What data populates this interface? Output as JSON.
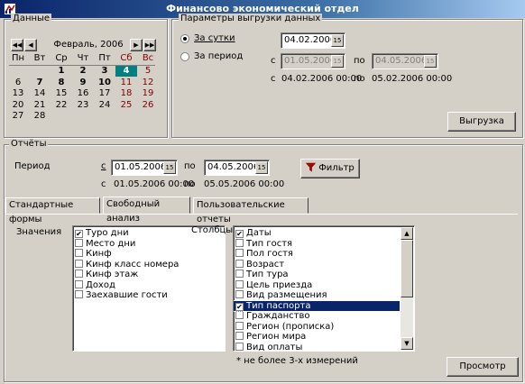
{
  "window": {
    "title": "Финансово экономический отдел"
  },
  "data_group": {
    "legend": "Данные",
    "calendar": {
      "month_label": "Февраль, 2006",
      "weekdays": [
        "Пн",
        "Вт",
        "Ср",
        "Чт",
        "Пт",
        "Сб",
        "Вс"
      ],
      "weeks": [
        [
          "",
          "",
          "1",
          "2",
          "3",
          "4",
          "5"
        ],
        [
          "6",
          "7",
          "8",
          "9",
          "10",
          "11",
          "12"
        ],
        [
          "13",
          "14",
          "15",
          "16",
          "17",
          "18",
          "19"
        ],
        [
          "20",
          "21",
          "22",
          "23",
          "24",
          "25",
          "26"
        ],
        [
          "27",
          "28",
          "",
          "",
          "",
          "",
          ""
        ]
      ],
      "selected_day": "4",
      "weekend_color": "#800000"
    }
  },
  "export_group": {
    "legend": "Параметры выгрузки данных",
    "radio_day": "За сутки",
    "radio_period": "За период",
    "day_value": "04.02.2006",
    "from_label": "с",
    "to_label": "по",
    "period_from": "01.05.2006",
    "period_to": "04.05.2006",
    "info_from": "04.02.2006 00:00",
    "info_to": "05.02.2006 00:00",
    "export_button": "Выгрузка"
  },
  "reports_group": {
    "legend": "Отчёты",
    "period_label": "Период",
    "from_label": "с",
    "to_label": "по",
    "from_value": "01.05.2006",
    "to_value": "04.05.2006",
    "info_from": "01.05.2006 00:00",
    "info_to": "05.05.2006 00:00",
    "filter_button": "Фильтр",
    "tabs": [
      "Стандартные формы",
      "Свободный анализ",
      "Пользовательские отчеты"
    ],
    "active_tab": 1,
    "values_label": "Значения",
    "values_items": [
      {
        "label": "Туро дни",
        "checked": true
      },
      {
        "label": "Место дни",
        "checked": false
      },
      {
        "label": "Кинф",
        "checked": false
      },
      {
        "label": "Кинф класс номера",
        "checked": false
      },
      {
        "label": "Кинф этаж",
        "checked": false
      },
      {
        "label": "Доход",
        "checked": false
      },
      {
        "label": "Заехавшие гости",
        "checked": false
      }
    ],
    "columns_label": "Столбцы *",
    "columns_items": [
      {
        "label": "Даты",
        "checked": true
      },
      {
        "label": "Тип гостя",
        "checked": false
      },
      {
        "label": "Пол гостя",
        "checked": false
      },
      {
        "label": "Возраст",
        "checked": false
      },
      {
        "label": "Тип тура",
        "checked": false
      },
      {
        "label": "Цель приезда",
        "checked": false
      },
      {
        "label": "Вид размещения",
        "checked": false
      },
      {
        "label": "Тип паспорта",
        "checked": true,
        "selected": true
      },
      {
        "label": "Гражданство",
        "checked": false
      },
      {
        "label": "Регион (прописка)",
        "checked": false
      },
      {
        "label": "Регион мира",
        "checked": false
      },
      {
        "label": "Вид оплаты",
        "checked": false
      }
    ],
    "columns_note": "* не более 3-х измерений",
    "view_button": "Просмотр"
  }
}
